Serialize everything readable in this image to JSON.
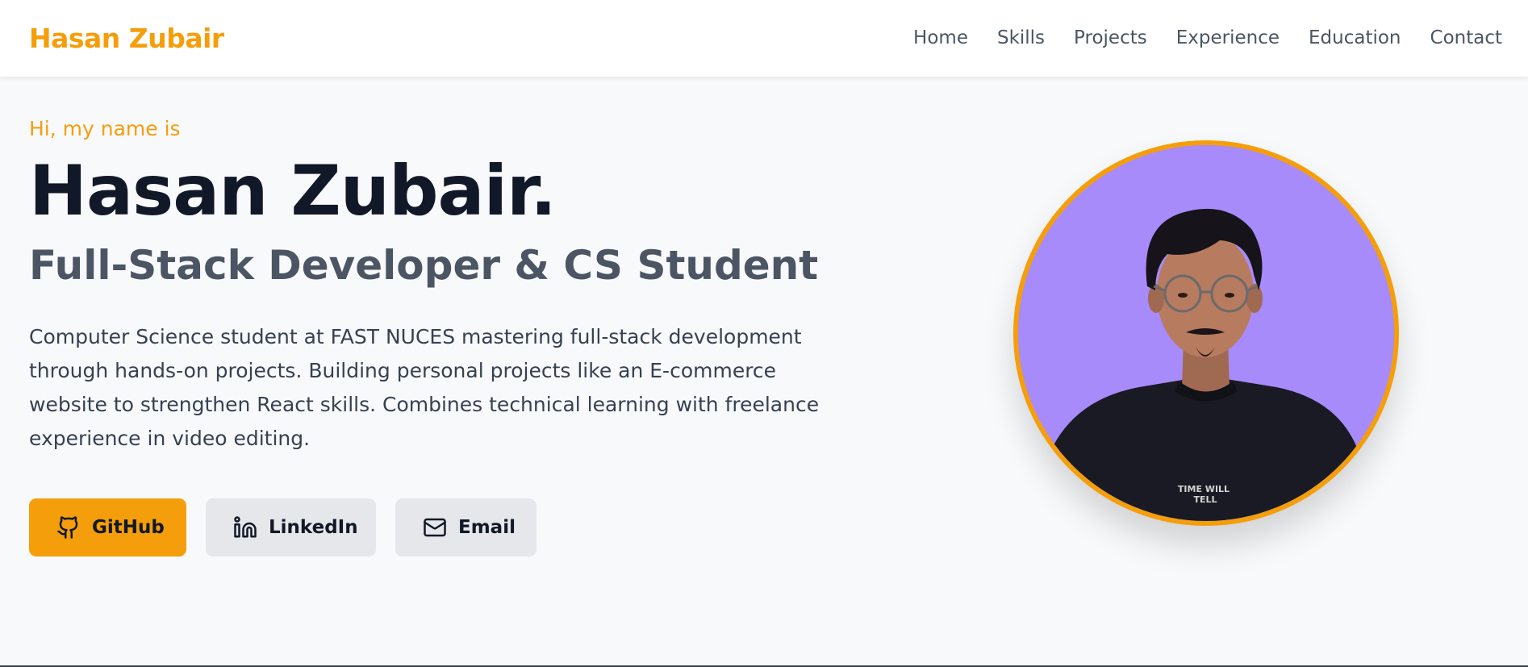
{
  "header": {
    "brand": "Hasan Zubair",
    "nav": [
      {
        "label": "Home"
      },
      {
        "label": "Skills"
      },
      {
        "label": "Projects"
      },
      {
        "label": "Experience"
      },
      {
        "label": "Education"
      },
      {
        "label": "Contact"
      }
    ]
  },
  "hero": {
    "greeting": "Hi, my name is",
    "name": "Hasan Zubair.",
    "subtitle": "Full-Stack Developer & CS Student",
    "bio": "Computer Science student at FAST NUCES mastering full-stack development through hands-on projects. Building personal projects like an E-commerce website to strengthen React skills. Combines technical learning with freelance experience in video editing.",
    "buttons": {
      "github": {
        "label": "GitHub",
        "icon": "github-icon"
      },
      "linkedin": {
        "label": "LinkedIn",
        "icon": "linkedin-icon"
      },
      "email": {
        "label": "Email",
        "icon": "mail-icon"
      }
    }
  },
  "profile": {
    "image": "profile-photo",
    "shirt_print": "TIME WILL TELL"
  },
  "colors": {
    "accent": "#f59e0b",
    "avatar_background": "#a78bfa",
    "heading": "#111827",
    "subtitle": "#4b5563",
    "page_background": "#f8f9fb"
  }
}
